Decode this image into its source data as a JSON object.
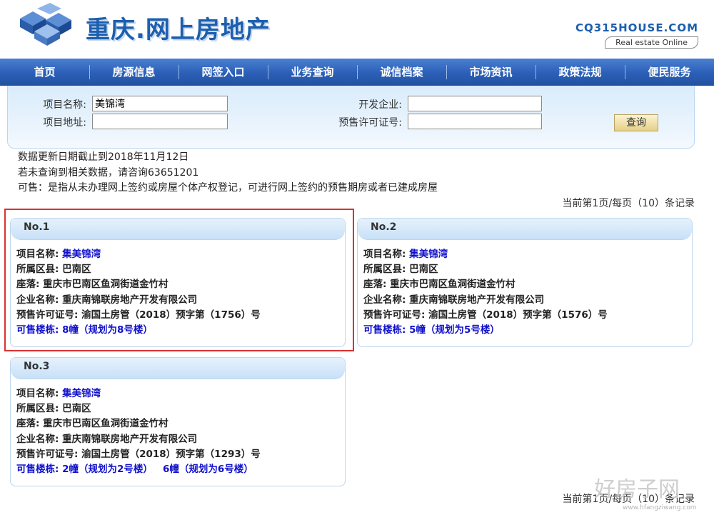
{
  "header": {
    "title": "重庆.网上房地产",
    "brand_code": "CQ315HOUSE.COM",
    "brand_sub": "Real estate Online"
  },
  "nav": [
    "首页",
    "房源信息",
    "网签入口",
    "业务查询",
    "诚信档案",
    "市场资讯",
    "政策法规",
    "便民服务"
  ],
  "search": {
    "project_name_label": "项目名称:",
    "project_name_value": "美锦湾",
    "project_addr_label": "项目地址:",
    "project_addr_value": "",
    "developer_label": "开发企业:",
    "developer_value": "",
    "permit_label": "预售许可证号:",
    "permit_value": "",
    "query_button": "查询"
  },
  "info": {
    "update_date": "数据更新日期截止到2018年11月12日",
    "consult": "若未查询到相关数据，请咨询63651201",
    "definition": "可售：是指从未办理网上签约或房屋个体产权登记，可进行网上签约的预售期房或者已建成房屋"
  },
  "pager": {
    "top": "当前第1页/每页（10）条记录",
    "bottom": "当前第1页/每页（10）条记录"
  },
  "cards": [
    {
      "no": "No.1",
      "name_label": "项目名称:",
      "name": "集美锦湾",
      "district_label": "所属区县:",
      "district": "巴南区",
      "location_label": "座落:",
      "location": "重庆市巴南区鱼洞街道金竹村",
      "company_label": "企业名称:",
      "company": "重庆南锦联房地产开发有限公司",
      "permit_label": "预售许可证号:",
      "permit": "渝国土房管（2018）预字第（1756）号",
      "buildings_label": "可售楼栋:",
      "buildings": "8幢（规划为8号楼）"
    },
    {
      "no": "No.2",
      "name_label": "项目名称:",
      "name": "集美锦湾",
      "district_label": "所属区县:",
      "district": "巴南区",
      "location_label": "座落:",
      "location": "重庆市巴南区鱼洞街道金竹村",
      "company_label": "企业名称:",
      "company": "重庆南锦联房地产开发有限公司",
      "permit_label": "预售许可证号:",
      "permit": "渝国土房管（2018）预字第（1576）号",
      "buildings_label": "可售楼栋:",
      "buildings": "5幢（规划为5号楼）"
    },
    {
      "no": "No.3",
      "name_label": "项目名称:",
      "name": "集美锦湾",
      "district_label": "所属区县:",
      "district": "巴南区",
      "location_label": "座落:",
      "location": "重庆市巴南区鱼洞街道金竹村",
      "company_label": "企业名称:",
      "company": "重庆南锦联房地产开发有限公司",
      "permit_label": "预售许可证号:",
      "permit": "渝国土房管（2018）预字第（1293）号",
      "buildings_label": "可售楼栋:",
      "buildings": "2幢（规划为2号楼）",
      "buildings_2": "6幢（规划为6号楼）"
    }
  ],
  "watermark": {
    "text": "好房子网",
    "url": "www.hfangziwang.com"
  },
  "colors": {
    "nav_blue": "#2b5fb7",
    "brand_blue": "#1d5fae",
    "link_blue": "#1010cc",
    "highlight_red": "#d93232"
  }
}
